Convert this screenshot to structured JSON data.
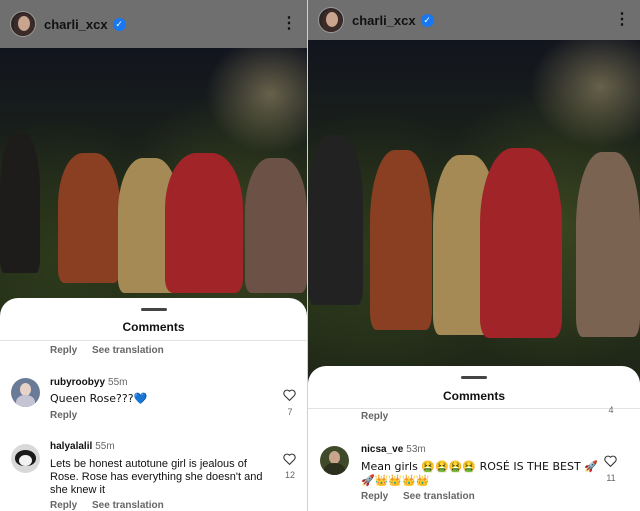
{
  "left": {
    "header": {
      "username": "charli_xcx"
    },
    "sheet": {
      "title": "Comments"
    },
    "prev_actions": {
      "reply": "Reply",
      "see_translation": "See translation"
    },
    "comments": [
      {
        "user": "rubyroobyy",
        "time": "55m",
        "text": "Queen Rose???💙",
        "likes": "7",
        "reply": "Reply",
        "see_translation": ""
      },
      {
        "user": "halyalalil",
        "time": "55m",
        "text": "Lets be honest autotune girl is jealous of Rose.  Rose has everything she doesn't and she knew it",
        "likes": "12",
        "reply": "Reply",
        "see_translation": "See translation"
      }
    ]
  },
  "right": {
    "header": {
      "username": "charli_xcx"
    },
    "sheet": {
      "title": "Comments"
    },
    "prev_actions": {
      "reply": "Reply",
      "likes_partial": "4"
    },
    "comments": [
      {
        "user": "nicsa_ve",
        "time": "53m",
        "text": "Mean girls 🤮🤮🤮🤮 ROSÉ IS THE BEST 🚀🚀👑👑👑👑",
        "likes": "11",
        "reply": "Reply",
        "see_translation": "See translation"
      }
    ]
  },
  "colors": {
    "verified": "#1877f2",
    "heart_outline": "#333333",
    "muted_text": "#666666"
  },
  "icons": {
    "verified": "verified-badge-icon",
    "more": "more-options-icon",
    "like": "heart-outline-icon"
  }
}
